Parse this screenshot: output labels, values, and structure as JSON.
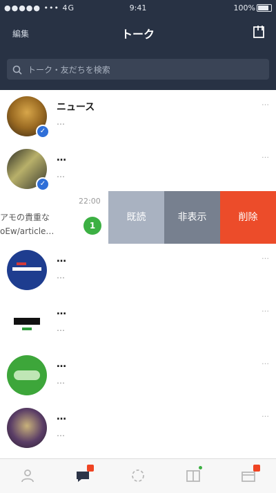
{
  "status": {
    "left": "●●●●● ••• 4G",
    "time": "9:41",
    "right": "100%"
  },
  "header": {
    "edit_label": "編集",
    "title": "トーク"
  },
  "search": {
    "placeholder": "トーク・友だちを検索"
  },
  "chats": [
    {
      "name": "ニュース",
      "preview": "…",
      "time": "…",
      "avatar_color": "#7a5a1e",
      "official": true
    },
    {
      "name": "…",
      "preview": "…",
      "time": "…",
      "avatar_color": "#4a4a3a",
      "official": true
    },
    {
      "name": "…",
      "preview": "…",
      "time": "…",
      "avatar_color": "#1e3d8f",
      "official": false
    },
    {
      "name": "…",
      "preview": "…",
      "time": "…",
      "avatar_color": "#1a1a1a",
      "official": false
    },
    {
      "name": "…",
      "preview": "…",
      "time": "…",
      "avatar_color": "#3da63a",
      "official": false
    },
    {
      "name": "…",
      "preview": "…",
      "time": "…",
      "avatar_color": "#6a4e3a",
      "official": false
    }
  ],
  "swiped_chat": {
    "time": "22:00",
    "preview_line1": "アモの貴重な",
    "preview_line2": "oEw/article…",
    "unread": "1"
  },
  "swipe_actions": {
    "read": "既読",
    "hide": "非表示",
    "delete": "削除"
  },
  "colors": {
    "header_bg": "#283244",
    "read_btn": "#a9b2c1",
    "hide_btn": "#77808f",
    "delete_btn": "#ec4c2a",
    "unread_badge": "#3cb043",
    "tab_badge": "#ef4423"
  },
  "tabs": [
    {
      "name": "home-icon"
    },
    {
      "name": "chat-icon"
    },
    {
      "name": "timeline-icon"
    },
    {
      "name": "news-icon"
    },
    {
      "name": "wallet-icon"
    }
  ]
}
